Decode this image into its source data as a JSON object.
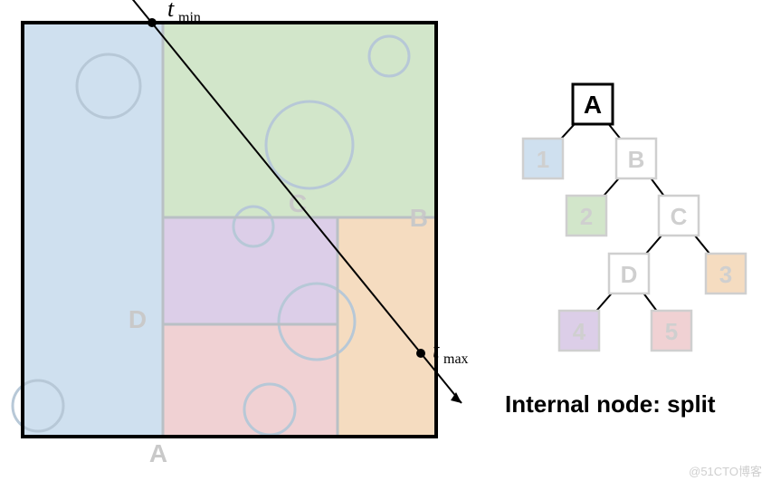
{
  "left": {
    "t_min_label": "t",
    "t_min_sub": "min",
    "t_max_label": "t",
    "t_max_sub": "max",
    "split_labels": {
      "A": "A",
      "B": "B",
      "C": "C",
      "D": "D"
    }
  },
  "tree": {
    "A": "A",
    "B": "B",
    "C": "C",
    "D": "D",
    "n1": "1",
    "n2": "2",
    "n3": "3",
    "n4": "4",
    "n5": "5"
  },
  "caption": "Internal node: split",
  "watermark": "@51CTO博客",
  "colors": {
    "blue": "#cfe0ef",
    "green": "#d2e6ca",
    "purple": "#dccee8",
    "pink": "#f0d1d3",
    "orange": "#f5dcc0",
    "circle": "#b7c8d7",
    "faint": "#d7d7d7",
    "text": "#222"
  },
  "diagram_semantics": {
    "description": "KD-tree style spatial partition with ray traversal",
    "regions": [
      {
        "id": "1",
        "split_by": "A",
        "color": "blue"
      },
      {
        "id": "2",
        "split_by": "B",
        "color": "green"
      },
      {
        "id": "3",
        "split_by": "C",
        "color": "orange"
      },
      {
        "id": "4",
        "split_by": "D",
        "color": "purple"
      },
      {
        "id": "5",
        "split_by": "D",
        "color": "pink"
      }
    ],
    "tree_edges": [
      [
        "A",
        "1"
      ],
      [
        "A",
        "B"
      ],
      [
        "B",
        "2"
      ],
      [
        "B",
        "C"
      ],
      [
        "C",
        "D"
      ],
      [
        "C",
        "3"
      ],
      [
        "D",
        "4"
      ],
      [
        "D",
        "5"
      ]
    ]
  }
}
